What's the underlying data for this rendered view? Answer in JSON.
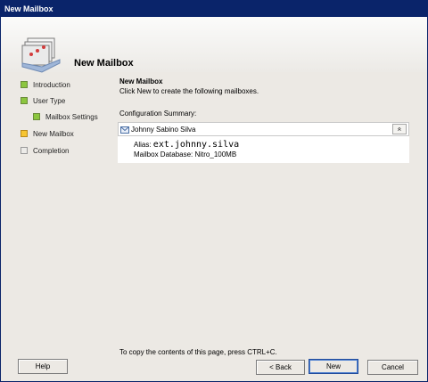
{
  "window": {
    "title": "New Mailbox"
  },
  "header": {
    "title": "New Mailbox",
    "icon": "mailbox-stack-icon"
  },
  "steps": [
    {
      "label": "Introduction",
      "state": "completed"
    },
    {
      "label": "User Type",
      "state": "completed"
    },
    {
      "label": "Mailbox Settings",
      "state": "completed"
    },
    {
      "label": "New Mailbox",
      "state": "current"
    },
    {
      "label": "Completion",
      "state": "pending"
    }
  ],
  "content": {
    "title": "New Mailbox",
    "description": "Click New to create the following mailboxes.",
    "config_label": "Configuration Summary:",
    "summary": {
      "name": "Johnny Sabino Silva",
      "alias_label": "Alias:",
      "alias_value": "ext.johnny.silva",
      "database_line": "Mailbox Database: Nitro_100MB",
      "collapse_glyph": "»"
    },
    "copy_hint": "To copy the contents of this page, press CTRL+C."
  },
  "buttons": {
    "help": "Help",
    "back": "< Back",
    "new": "New",
    "cancel": "Cancel"
  },
  "colors": {
    "titlebar": "#0a246a",
    "step_done": "#8cc63f",
    "step_current": "#f7c531"
  }
}
